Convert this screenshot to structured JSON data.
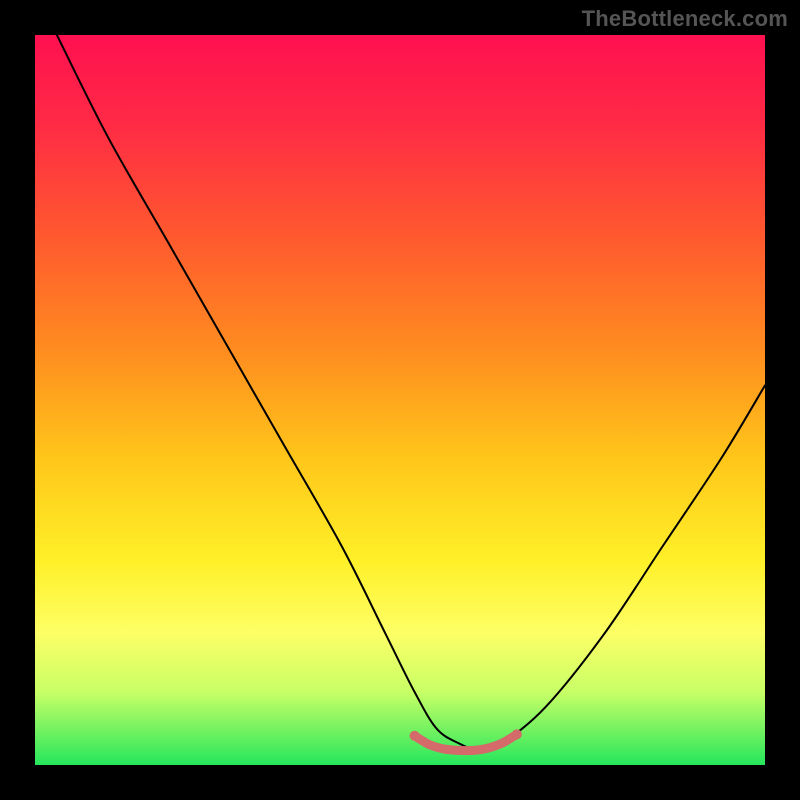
{
  "watermark": "TheBottleneck.com",
  "chart_data": {
    "type": "line",
    "title": "",
    "xlabel": "",
    "ylabel": "",
    "xlim": [
      0,
      100
    ],
    "ylim": [
      0,
      100
    ],
    "gradient_stops": [
      {
        "offset": 0,
        "color": "#ff1050"
      },
      {
        "offset": 12,
        "color": "#ff2a45"
      },
      {
        "offset": 28,
        "color": "#ff5a2e"
      },
      {
        "offset": 44,
        "color": "#ff8f1f"
      },
      {
        "offset": 58,
        "color": "#ffc61a"
      },
      {
        "offset": 72,
        "color": "#fff028"
      },
      {
        "offset": 82,
        "color": "#fdff66"
      },
      {
        "offset": 90,
        "color": "#c8ff66"
      },
      {
        "offset": 100,
        "color": "#25e65c"
      }
    ],
    "series": [
      {
        "name": "main-curve",
        "color": "#000000",
        "stroke_width": 2,
        "x": [
          3,
          10,
          18,
          26,
          34,
          42,
          48,
          52,
          55,
          58,
          61,
          64,
          70,
          78,
          86,
          94,
          100
        ],
        "values": [
          100,
          86,
          72,
          58,
          44,
          30,
          18,
          10,
          5,
          3,
          2,
          3,
          8,
          18,
          30,
          42,
          52
        ]
      },
      {
        "name": "tolerance-band",
        "color": "#d46a6a",
        "stroke_width": 9,
        "x": [
          52,
          54,
          56,
          58,
          60,
          62,
          64,
          66
        ],
        "values": [
          4.0,
          2.8,
          2.2,
          2.0,
          2.0,
          2.3,
          3.0,
          4.2
        ]
      }
    ],
    "markers": [
      {
        "name": "range-dot-left",
        "x": 52,
        "y": 4.0,
        "color": "#d46a6a",
        "r": 5
      },
      {
        "name": "range-dot-right",
        "x": 66,
        "y": 4.2,
        "color": "#d46a6a",
        "r": 5
      }
    ]
  }
}
